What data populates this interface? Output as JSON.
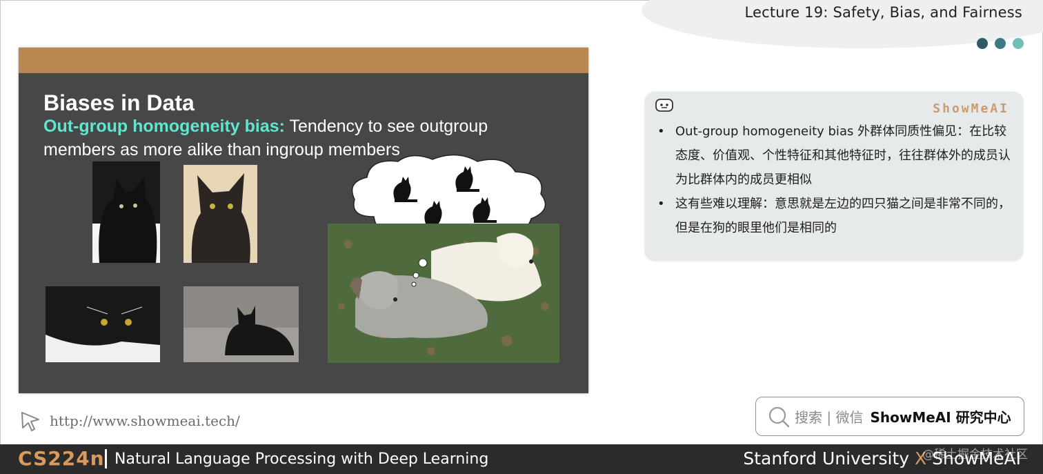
{
  "header": {
    "lecture_title": "Lecture 19: Safety, Bias, and Fairness",
    "dot_colors": [
      "#2e5b66",
      "#3d7884",
      "#6fc0b8"
    ]
  },
  "slide": {
    "title": "Biases in Data",
    "term": "Out-group homogeneity bias:",
    "definition": " Tendency to see outgroup members as more alike than ingroup members",
    "colors": {
      "bar": "#b88752",
      "background": "#474747",
      "term": "#5ee6d1"
    }
  },
  "notes": {
    "icon": "robot-icon",
    "brand": "ShowMeAI",
    "items": [
      "Out-group homogeneity bias 外群体同质性偏见：在比较态度、价值观、个性特征和其他特征时，往往群体外的成员认为比群体内的成员更相似",
      "这有些难以理解：意思就是左边的四只猫之间是非常不同的，但是在狗的眼里他们是相同的"
    ]
  },
  "link": {
    "icon": "cursor-icon",
    "url": "http://www.showmeai.tech/"
  },
  "search": {
    "icon": "search-icon",
    "hint": "搜索 | 微信",
    "brand": "ShowMeAI 研究中心"
  },
  "footer": {
    "course_code": "CS224n",
    "course_name": "Natural Language Processing with Deep Learning",
    "university": "Stanford University",
    "x": "X",
    "brand": "ShowMeAI",
    "watermark": "@稀土掘金技术社区"
  }
}
